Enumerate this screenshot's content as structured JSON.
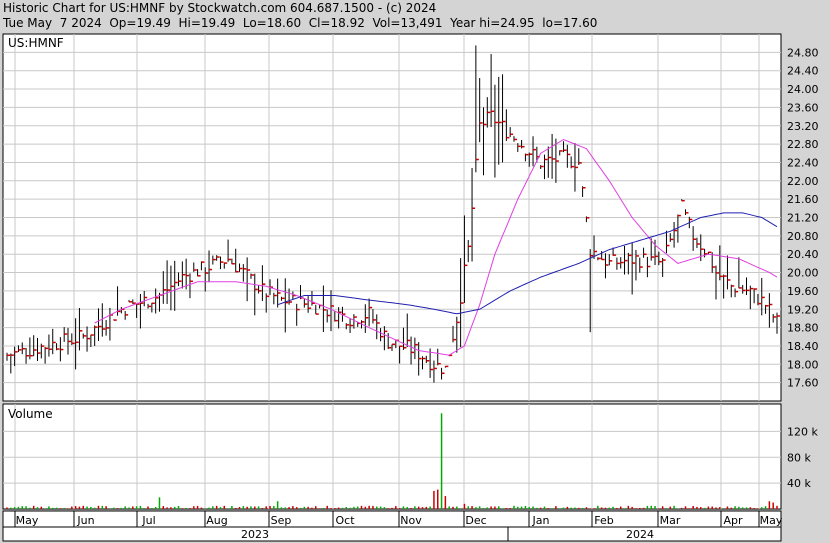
{
  "header": {
    "line1": "Historic Chart for US:HMNF by Stockwatch.com 604.687.1500 - (c) 2024",
    "line2": "Tue May  7 2024  Op=19.49  Hi=19.49  Lo=18.60  Cl=18.92  Vol=13,491  Year hi=24.95  lo=17.60"
  },
  "colors": {
    "background": "#d4d4d4",
    "plot_bg": "#ffffff",
    "grid": "#c8c8c8",
    "bar": "#000000",
    "close_tick": "#cc0000",
    "ma_short": "#e040e0",
    "ma_long": "#2020b0",
    "volume_up": "#00aa00",
    "volume_down": "#cc0000"
  },
  "chart_data": [
    {
      "type": "ohlc",
      "title": "US:HMNF",
      "ylim": [
        17.2,
        25.2
      ],
      "yticks": [
        "24.80",
        "24.40",
        "24.00",
        "23.60",
        "23.20",
        "22.80",
        "22.40",
        "22.00",
        "21.60",
        "21.20",
        "20.80",
        "20.40",
        "20.00",
        "19.60",
        "19.20",
        "18.80",
        "18.40",
        "18.00",
        "17.60"
      ],
      "xticks": [
        "May",
        "Jun",
        "Jul",
        "Aug",
        "Sep",
        "Oct",
        "Nov",
        "Dec",
        "Jan",
        "Feb",
        "Mar",
        "Apr",
        "May"
      ],
      "years": [
        "2023",
        "2024"
      ],
      "anchors": [
        [
          0,
          18.2
        ],
        [
          10,
          18.4
        ],
        [
          20,
          18.6
        ],
        [
          30,
          19.2
        ],
        [
          40,
          19.5
        ],
        [
          46,
          19.9
        ],
        [
          52,
          20.1
        ],
        [
          58,
          20.3
        ],
        [
          62,
          20.0
        ],
        [
          67,
          19.6
        ],
        [
          72,
          19.4
        ],
        [
          80,
          19.3
        ],
        [
          90,
          19.0
        ],
        [
          95,
          19.1
        ],
        [
          100,
          18.5
        ],
        [
          107,
          18.3
        ],
        [
          112,
          18.0
        ],
        [
          115,
          17.9
        ],
        [
          118,
          19.0
        ],
        [
          121,
          20.5
        ],
        [
          124,
          23.2
        ],
        [
          127,
          23.4
        ],
        [
          131,
          23.1
        ],
        [
          135,
          22.8
        ],
        [
          140,
          22.4
        ],
        [
          146,
          22.5
        ],
        [
          150,
          22.4
        ],
        [
          153,
          20.5
        ],
        [
          158,
          20.2
        ],
        [
          165,
          20.3
        ],
        [
          172,
          20.2
        ],
        [
          177,
          21.4
        ],
        [
          180,
          20.8
        ],
        [
          184,
          20.4
        ],
        [
          186,
          20.0
        ],
        [
          190,
          19.7
        ],
        [
          195,
          19.6
        ],
        [
          199,
          19.3
        ],
        [
          202,
          18.92
        ]
      ],
      "ma_short_anchors": [
        [
          23,
          18.9
        ],
        [
          30,
          19.2
        ],
        [
          40,
          19.5
        ],
        [
          50,
          19.8
        ],
        [
          60,
          19.8
        ],
        [
          68,
          19.7
        ],
        [
          76,
          19.5
        ],
        [
          85,
          19.2
        ],
        [
          95,
          18.8
        ],
        [
          108,
          18.3
        ],
        [
          116,
          18.2
        ],
        [
          120,
          18.4
        ],
        [
          124,
          19.3
        ],
        [
          128,
          20.4
        ],
        [
          134,
          21.6
        ],
        [
          140,
          22.6
        ],
        [
          146,
          22.9
        ],
        [
          152,
          22.7
        ],
        [
          158,
          22.0
        ],
        [
          164,
          21.2
        ],
        [
          170,
          20.6
        ],
        [
          176,
          20.2
        ],
        [
          184,
          20.4
        ],
        [
          192,
          20.3
        ],
        [
          200,
          20.0
        ],
        [
          202,
          19.9
        ]
      ],
      "ma_long_anchors": [
        [
          71,
          19.3
        ],
        [
          78,
          19.5
        ],
        [
          86,
          19.5
        ],
        [
          95,
          19.4
        ],
        [
          105,
          19.3
        ],
        [
          112,
          19.2
        ],
        [
          118,
          19.1
        ],
        [
          124,
          19.2
        ],
        [
          132,
          19.6
        ],
        [
          140,
          19.9
        ],
        [
          150,
          20.2
        ],
        [
          158,
          20.5
        ],
        [
          166,
          20.7
        ],
        [
          174,
          20.9
        ],
        [
          182,
          21.2
        ],
        [
          188,
          21.3
        ],
        [
          193,
          21.3
        ],
        [
          198,
          21.2
        ],
        [
          202,
          21.0
        ]
      ]
    },
    {
      "type": "bar",
      "title": "Volume",
      "ylim": [
        0,
        150
      ],
      "yticks": [
        "120 k",
        "80 k",
        "40 k"
      ],
      "ytick_values": [
        120,
        80,
        40
      ],
      "spikes": [
        [
          114,
          148
        ],
        [
          113,
          30
        ],
        [
          112,
          28
        ],
        [
          115,
          20
        ],
        [
          40,
          18
        ],
        [
          71,
          12
        ],
        [
          120,
          8
        ],
        [
          200,
          12
        ],
        [
          201,
          10
        ]
      ]
    }
  ]
}
